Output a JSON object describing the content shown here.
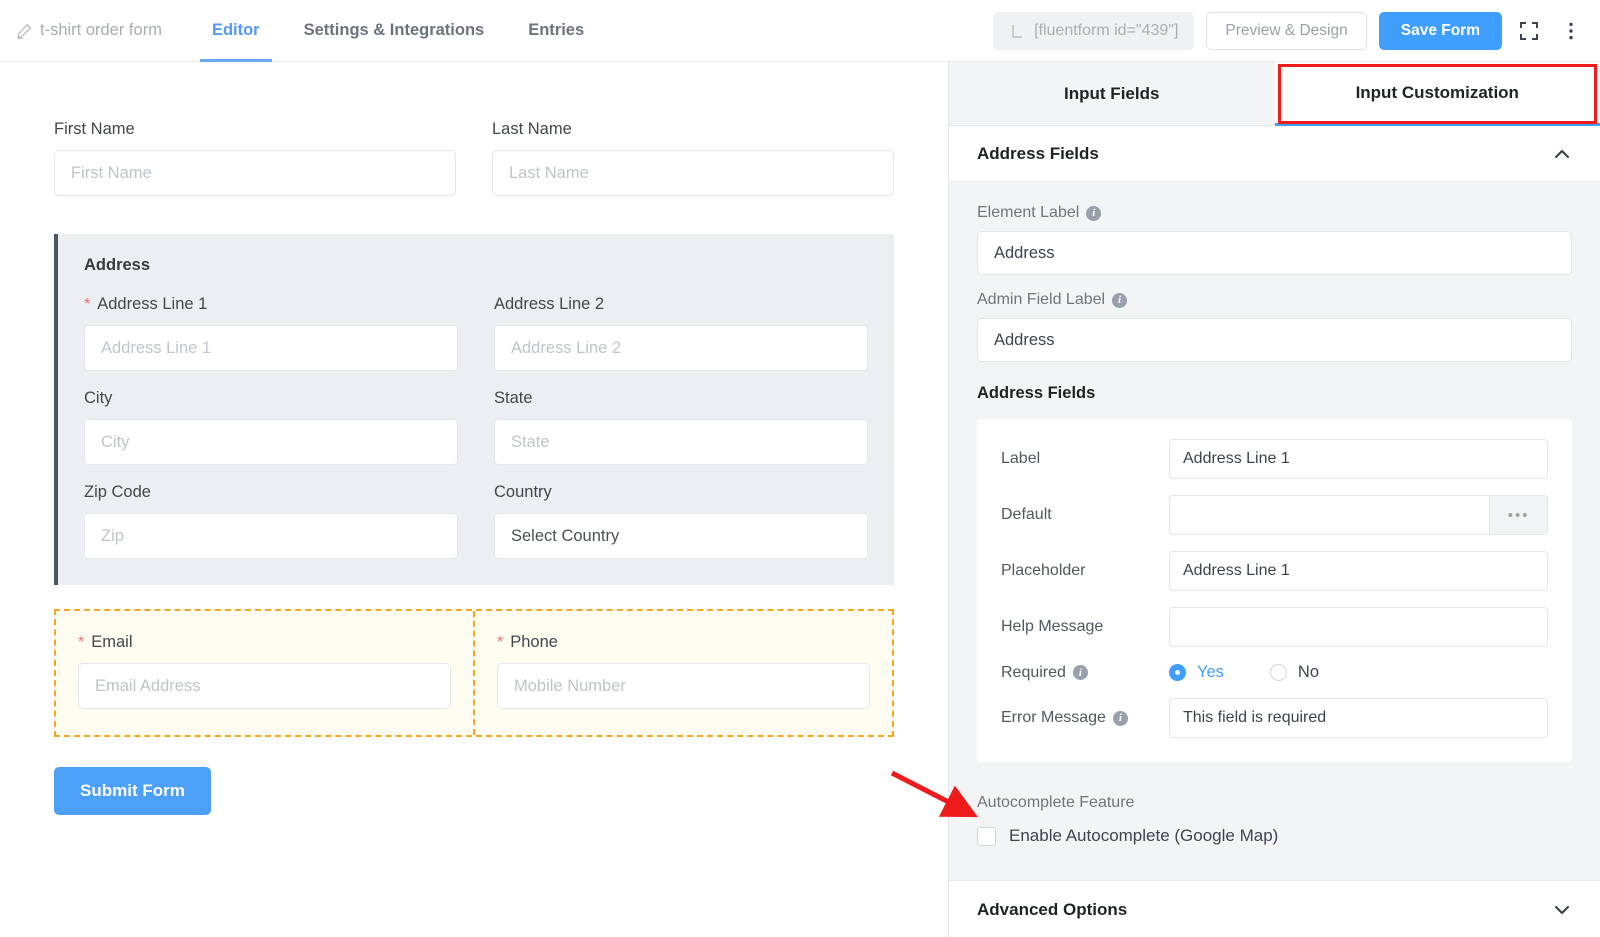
{
  "topbar": {
    "form_name": "t-shirt order form",
    "pencil_icon": "pencil-icon",
    "tabs": [
      {
        "label": "Editor",
        "active": true
      },
      {
        "label": "Settings & Integrations",
        "active": false
      },
      {
        "label": "Entries",
        "active": false
      }
    ],
    "shortcode": "[fluentform id=\"439\"]",
    "shortcode_icon": "shortcode-icon",
    "preview_label": "Preview & Design",
    "save_label": "Save Form",
    "fullscreen_icon": "fullscreen-icon",
    "more_icon": "more-vertical-icon"
  },
  "form": {
    "name_row": [
      {
        "label": "First Name",
        "placeholder": "First Name",
        "required": false
      },
      {
        "label": "Last Name",
        "placeholder": "Last Name",
        "required": false
      }
    ],
    "address": {
      "title": "Address",
      "fields": [
        {
          "label": "Address Line 1",
          "placeholder": "Address Line 1",
          "required": true
        },
        {
          "label": "Address Line 2",
          "placeholder": "Address Line 2",
          "required": false
        },
        {
          "label": "City",
          "placeholder": "City",
          "required": false
        },
        {
          "label": "State",
          "placeholder": "State",
          "required": false
        },
        {
          "label": "Zip Code",
          "placeholder": "Zip",
          "required": false
        }
      ],
      "country": {
        "label": "Country",
        "value": "Select Country",
        "required": false
      }
    },
    "contact_row": [
      {
        "label": "Email",
        "placeholder": "Email Address",
        "required": true
      },
      {
        "label": "Phone",
        "placeholder": "Mobile Number",
        "required": true
      }
    ],
    "submit_label": "Submit Form"
  },
  "panel": {
    "tabs": [
      {
        "label": "Input Fields",
        "active": false
      },
      {
        "label": "Input Customization",
        "active": true
      }
    ],
    "section": {
      "title": "Address Fields",
      "collapse_icon": "chevron-up-icon",
      "element_label": {
        "label": "Element Label",
        "value": "Address",
        "info_icon": "info-icon"
      },
      "admin_field_label": {
        "label": "Admin Field Label",
        "value": "Address",
        "info_icon": "info-icon"
      },
      "subsection_title": "Address Fields",
      "card": {
        "label_row": {
          "label": "Label",
          "value": "Address Line 1"
        },
        "default_row": {
          "label": "Default",
          "value": "",
          "button_label": "•••",
          "button_icon": "ellipsis-icon"
        },
        "placeholder_row": {
          "label": "Placeholder",
          "value": "Address Line 1"
        },
        "help_row": {
          "label": "Help Message",
          "value": ""
        },
        "required_row": {
          "label": "Required",
          "info_icon": "info-icon",
          "options": [
            {
              "label": "Yes",
              "selected": true
            },
            {
              "label": "No",
              "selected": false
            }
          ]
        },
        "error_row": {
          "label": "Error Message",
          "value": "This field is required",
          "info_icon": "info-icon"
        }
      },
      "autocomplete": {
        "label": "Autocomplete Feature",
        "checkbox_label": "Enable Autocomplete (Google Map)",
        "checked": false
      }
    },
    "advanced": {
      "title": "Advanced Options",
      "expand_icon": "chevron-down-icon"
    }
  },
  "annotations": {
    "arrow_color": "#ee1b1b",
    "highlight_box_color": "#f01c1c"
  },
  "colors": {
    "accent_blue": "#409EFF",
    "required_star": "#fb6a6a",
    "dashed_highlight": "#f5a623",
    "address_accent": "#4a5764"
  }
}
